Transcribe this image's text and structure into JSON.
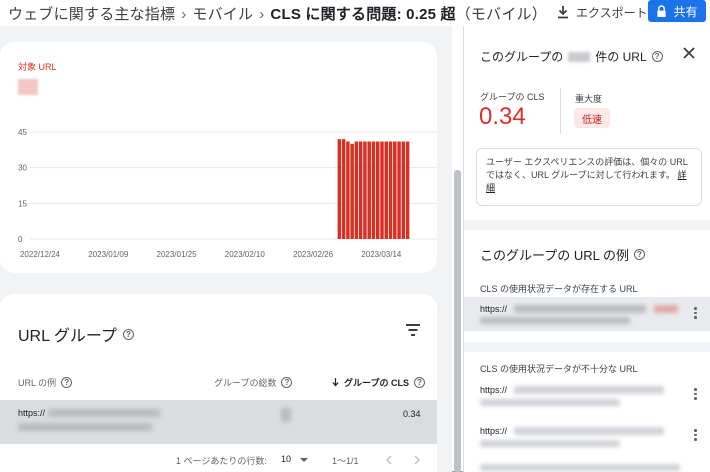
{
  "header": {
    "crumb1": "ウェブに関する主な指標",
    "sep": "›",
    "crumb2": "モバイル",
    "crumb3_prefix": "CLS に関する問題:",
    "crumb3_value": "0.25 超",
    "crumb3_suffix": "（モバイル）",
    "export_label": "エクスポート",
    "share_label": "共有"
  },
  "chart_card": {
    "target_label": "対象 URL"
  },
  "chart_data": {
    "type": "bar",
    "color": "#d93025",
    "y_ticks": [
      "0",
      "15",
      "30",
      "45"
    ],
    "ylim": [
      0,
      45
    ],
    "x_labels": [
      "2022/12/24",
      "2023/01/09",
      "2023/01/25",
      "2023/02/10",
      "2023/02/26",
      "2023/03/14"
    ],
    "x_start": "2022/12/24",
    "x_end": "2023/03/23",
    "series": [
      {
        "points": [
          {
            "x": "2023/03/06",
            "y": 42
          },
          {
            "x": "2023/03/07",
            "y": 42
          },
          {
            "x": "2023/03/08",
            "y": 41
          },
          {
            "x": "2023/03/09",
            "y": 40
          },
          {
            "x": "2023/03/10",
            "y": 41
          },
          {
            "x": "2023/03/11",
            "y": 41
          },
          {
            "x": "2023/03/12",
            "y": 41
          },
          {
            "x": "2023/03/13",
            "y": 41
          },
          {
            "x": "2023/03/14",
            "y": 41
          },
          {
            "x": "2023/03/15",
            "y": 41
          },
          {
            "x": "2023/03/16",
            "y": 41
          },
          {
            "x": "2023/03/17",
            "y": 41
          },
          {
            "x": "2023/03/18",
            "y": 41
          },
          {
            "x": "2023/03/19",
            "y": 41
          },
          {
            "x": "2023/03/20",
            "y": 41
          },
          {
            "x": "2023/03/21",
            "y": 41
          },
          {
            "x": "2023/03/22",
            "y": 41
          }
        ]
      }
    ],
    "grid": true
  },
  "table": {
    "title": "URL グループ",
    "col_url": "URL の例",
    "col_total": "グループの総数",
    "col_cls": "グループの CLS",
    "rows": [
      {
        "url": "https://",
        "cls": "0.34"
      }
    ],
    "rows_per_page_label": "1 ページあたりの行数:",
    "rows_per_page_value": "10",
    "page_range": "1〜1/1"
  },
  "panel": {
    "title_prefix": "このグループの",
    "title_suffix": "件の URL",
    "group_cls_label": "グループの CLS",
    "group_cls_value": "0.34",
    "severity_label": "重大度",
    "severity_value": "低速",
    "info_text": "ユーザー エクスペリエンスの評価は、個々の URL ではなく、URL グループに対して行われます。",
    "info_link": "詳細",
    "examples_title": "このグループの URL の例",
    "with_data_label": "CLS の使用状況データが存在する URL",
    "without_data_label": "CLS の使用状況データが不十分な URL",
    "with_data_urls": [
      "https://"
    ],
    "without_data_urls": [
      "https://",
      "https://"
    ]
  }
}
